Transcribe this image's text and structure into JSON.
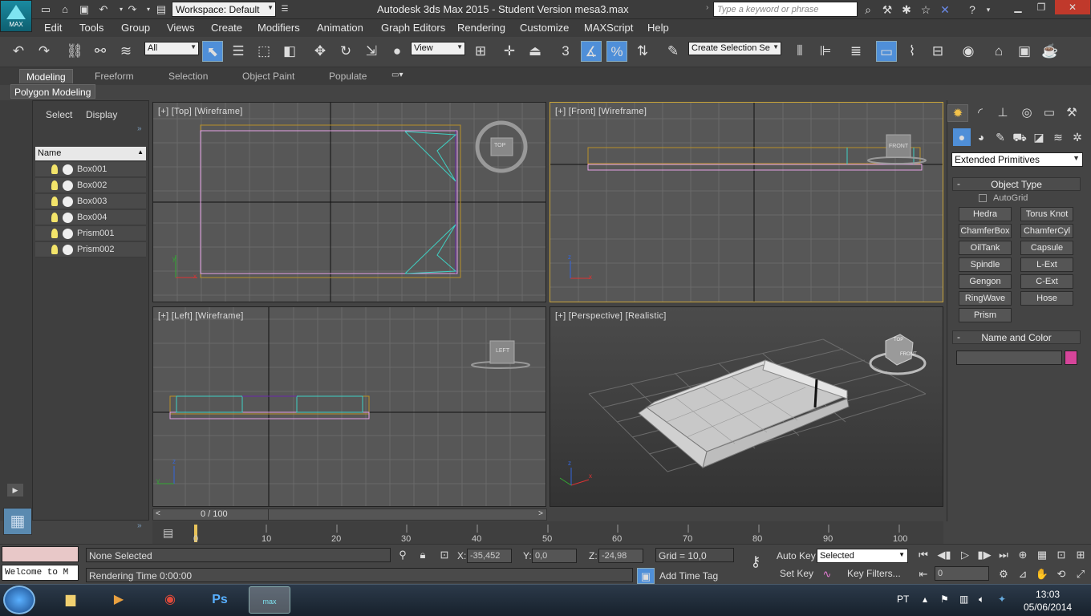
{
  "window": {
    "title": "Autodesk 3ds Max  2015  -  Student Version    mesa3.max",
    "workspace": "Workspace: Default",
    "search_placeholder": "Type a keyword or phrase",
    "logo_text": "MAX"
  },
  "menu": [
    "Edit",
    "Tools",
    "Group",
    "Views",
    "Create",
    "Modifiers",
    "Animation",
    "Graph Editors",
    "Rendering",
    "Customize",
    "MAXScript",
    "Help"
  ],
  "toolbar": {
    "selection_filter": "All",
    "ref_coord": "View",
    "snap_label": "3",
    "named_selection": "Create Selection Se"
  },
  "ribbon": {
    "tabs": [
      "Modeling",
      "Freeform",
      "Selection",
      "Object Paint",
      "Populate"
    ],
    "active_tab": "Modeling",
    "panel": "Polygon Modeling"
  },
  "scene_explorer": {
    "tabs": [
      "Select",
      "Display"
    ],
    "column": "Name",
    "objects": [
      "Box001",
      "Box002",
      "Box003",
      "Box004",
      "Prism001",
      "Prism002"
    ]
  },
  "viewports": {
    "top": {
      "label": "[+] [Top] [Wireframe]",
      "cube": "TOP"
    },
    "front": {
      "label": "[+] [Front] [Wireframe]",
      "cube": "FRONT"
    },
    "left": {
      "label": "[+] [Left] [Wireframe]",
      "cube": "LEFT"
    },
    "persp": {
      "label": "[+] [Perspective] [Realistic]",
      "cube_top": "TOP",
      "cube_front": "FRONT"
    },
    "axis_x": "x",
    "axis_y": "y",
    "axis_z": "z"
  },
  "timeline": {
    "slider_text": "0 / 100",
    "ticks": [
      "0",
      "10",
      "20",
      "30",
      "40",
      "50",
      "60",
      "70",
      "80",
      "90",
      "100"
    ]
  },
  "command_panel": {
    "category": "Extended Primitives",
    "object_type_title": "Object Type",
    "autogrid": "AutoGrid",
    "buttons": [
      "Hedra",
      "Torus Knot",
      "ChamferBox",
      "ChamferCyl",
      "OilTank",
      "Capsule",
      "Spindle",
      "L-Ext",
      "Gengon",
      "C-Ext",
      "RingWave",
      "Hose",
      "Prism"
    ],
    "name_color_title": "Name and Color",
    "color": "#d6459a"
  },
  "status": {
    "maxscript": "Welcome to M",
    "selection": "None Selected",
    "render_time": "Rendering Time  0:00:00",
    "x_label": "X:",
    "x_value": "-35,452",
    "y_label": "Y:",
    "y_value": "0,0",
    "z_label": "Z:",
    "z_value": "-24,98",
    "grid": "Grid = 10,0",
    "add_time_tag": "Add Time Tag",
    "auto_key": "Auto Key",
    "set_key": "Set Key",
    "key_mode": "Selected",
    "key_filters": "Key Filters...",
    "frame": "0"
  },
  "taskbar": {
    "lang": "PT",
    "time": "13:03",
    "date": "05/06/2014",
    "active_app_label": "max"
  }
}
